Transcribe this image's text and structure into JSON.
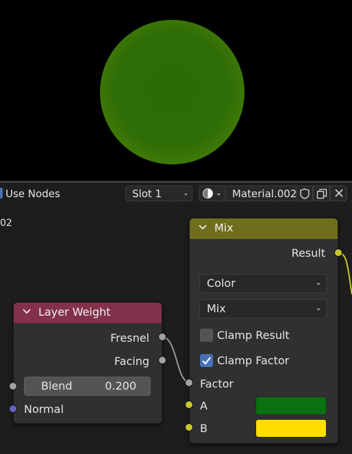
{
  "header": {
    "use_nodes_label": "Use Nodes",
    "slot_value": "Slot 1",
    "material_name": "Material.002"
  },
  "tree_label": "02",
  "layer_weight_node": {
    "title": "Layer Weight",
    "outputs": [
      "Fresnel",
      "Facing"
    ],
    "blend_label": "Blend",
    "blend_value": "0.200",
    "normal_label": "Normal"
  },
  "mix_node": {
    "title": "Mix",
    "result_label": "Result",
    "data_type": "Color",
    "blend_mode": "Mix",
    "clamp_result_label": "Clamp Result",
    "clamp_result_checked": false,
    "clamp_factor_label": "Clamp Factor",
    "clamp_factor_checked": true,
    "factor_label": "Factor",
    "a_label": "A",
    "b_label": "B",
    "a_color": "#0b7010",
    "b_color": "#ffdd00"
  },
  "colors": {
    "layer_weight_header": "#83314a",
    "mix_header": "#6e6e1c",
    "accent": "#4772b3"
  }
}
